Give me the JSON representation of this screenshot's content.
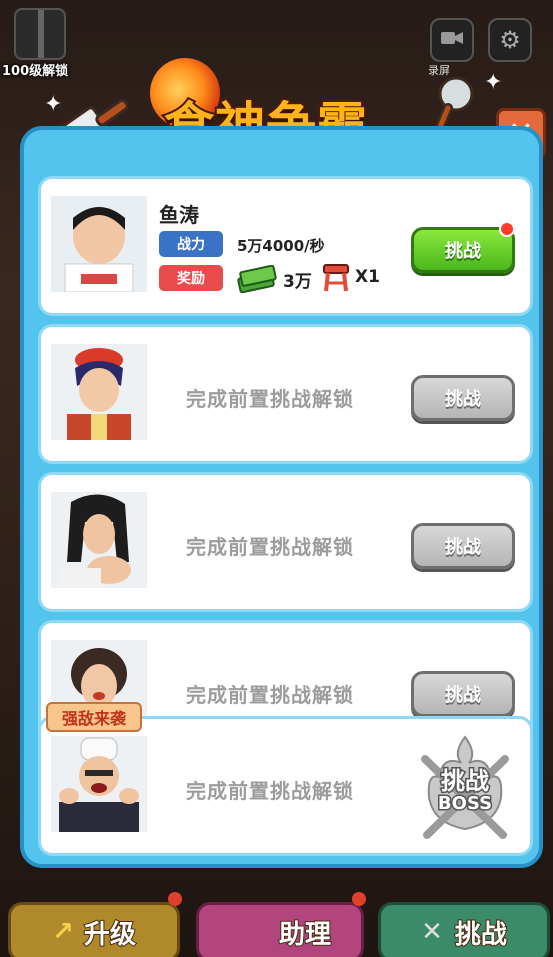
{
  "hud": {
    "gift_label": "100级解锁",
    "record_label": "录屏",
    "settings_icon": "gear-icon",
    "record_icon": "video-camera-icon"
  },
  "title": "食神争霸",
  "close_label": "✕",
  "challengers": [
    {
      "name": "鱼涛",
      "power_tag": "战力",
      "power_value": "5万4000/秒",
      "reward_tag": "奖励",
      "cash_value": "3万",
      "stool_value": "X1",
      "button_label": "挑战",
      "unlocked": true
    },
    {
      "locked_text": "完成前置挑战解锁",
      "button_label": "挑战",
      "unlocked": false
    },
    {
      "locked_text": "完成前置挑战解锁",
      "button_label": "挑战",
      "unlocked": false
    },
    {
      "locked_text": "完成前置挑战解锁",
      "button_label": "挑战",
      "unlocked": false
    },
    {
      "locked_text": "完成前置挑战解锁",
      "boss_line1": "挑战",
      "boss_line2": "BOSS",
      "unlocked": false
    }
  ],
  "enemy_label": "强敌来袭",
  "bottom_nav": {
    "upgrade": "升级",
    "assistant": "助理",
    "challenge": "挑战"
  },
  "colors": {
    "panel": "#52c4ee",
    "active_button": "#4ab81c",
    "locked_button": "#b5b5b5",
    "title": "#ffb31a"
  }
}
